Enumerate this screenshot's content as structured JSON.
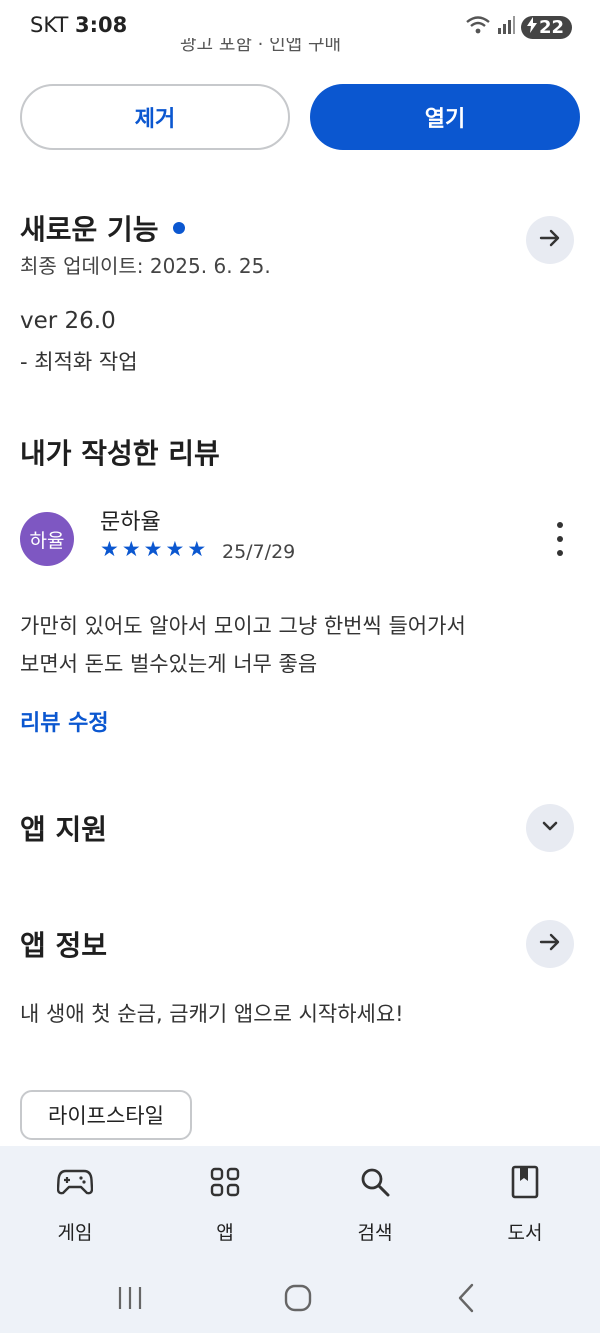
{
  "status_bar": {
    "carrier": "SKT",
    "time": "3:08",
    "battery": "22"
  },
  "top_cut_text": "광고 포함 · 인앱 구매",
  "buttons": {
    "remove": "제거",
    "open": "열기"
  },
  "whats_new": {
    "title": "새로운 기능",
    "last_updated": "최종 업데이트: 2025. 6. 25.",
    "version": "ver 26.0",
    "note": "- 최적화 작업"
  },
  "my_review": {
    "title": "내가 작성한 리뷰",
    "avatar_text": "하율",
    "reviewer": "문하율",
    "rating": 5,
    "date": "25/7/29",
    "text_line1": "가만히 있어도 알아서 모이고 그냥 한번씩 들어가서",
    "text_line2": "보면서 돈도 벌수있는게 너무 좋음",
    "edit_label": "리뷰 수정"
  },
  "app_support": {
    "title": "앱 지원"
  },
  "app_info": {
    "title": "앱 정보",
    "description": "내 생애 첫 순금, 금캐기 앱으로 시작하세요!",
    "category": "라이프스타일"
  },
  "bottom_nav": [
    {
      "label": "게임",
      "icon": "gamepad-icon"
    },
    {
      "label": "앱",
      "icon": "apps-grid-icon"
    },
    {
      "label": "검색",
      "icon": "search-icon"
    },
    {
      "label": "도서",
      "icon": "book-icon"
    }
  ],
  "colors": {
    "accent": "#0b57d0",
    "avatar": "#7e57c2",
    "nav_bg": "#eef2f8"
  }
}
